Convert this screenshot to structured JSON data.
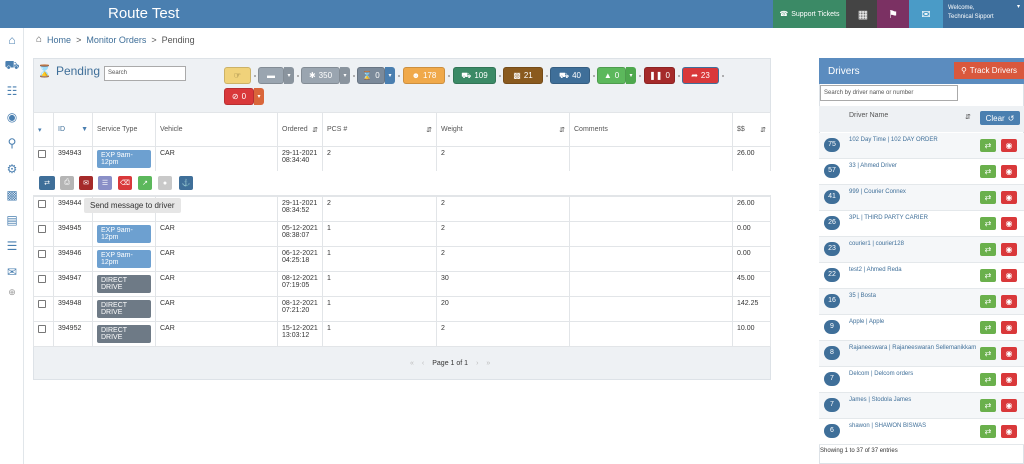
{
  "header": {
    "title": "Route Test",
    "support_label": "Support Tickets",
    "welcome_line1": "Welcome,",
    "welcome_line2": "Technical Sipport",
    "colors": {
      "bar": "#4a7fb0",
      "support": "#3b8a66",
      "notify": "#7b3163",
      "chat": "#4a9bc7"
    }
  },
  "sidebar": {
    "icons": [
      "home-icon",
      "truck-icon",
      "calendar-icon",
      "bicycle-icon",
      "search-icon",
      "gear-icon",
      "building-icon",
      "book-icon",
      "list-icon",
      "envelope-icon",
      "expand-icon"
    ]
  },
  "breadcrumb": {
    "home": "Home",
    "sep1": ">",
    "monitor": "Monitor Orders",
    "sep2": ">",
    "current": "Pending"
  },
  "pending": {
    "title": "Pending",
    "search_placeholder": "Search",
    "filters": [
      {
        "name": "pickup-filter",
        "label": "",
        "color": "#f0d27a"
      },
      {
        "name": "card-filter",
        "label": "",
        "color": "#9aa5b0"
      },
      {
        "name": "all-filter",
        "label": "350",
        "color": "#9aa5b0"
      },
      {
        "name": "hourglass-filter",
        "label": "0",
        "color": "#4a7fb0"
      },
      {
        "name": "assigned-filter",
        "label": "178",
        "color": "#f0a94a"
      },
      {
        "name": "car-filter",
        "label": "109",
        "color": "#3b8a66"
      },
      {
        "name": "warehouse-filter",
        "label": "21",
        "color": "#8a5a1e"
      },
      {
        "name": "delivery-filter",
        "label": "40",
        "color": "#3f6f99"
      },
      {
        "name": "delivered-filter",
        "label": "0",
        "color": "#5cb85c"
      },
      {
        "name": "paused-filter",
        "label": "0",
        "color": "#a52a2a"
      },
      {
        "name": "returned-filter",
        "label": "23",
        "color": "#d9383a"
      },
      {
        "name": "cancelled-filter",
        "label": "0",
        "color": "#d9383a"
      }
    ]
  },
  "table": {
    "columns": [
      "",
      "ID",
      "Service Type",
      "Vehicle",
      "Ordered",
      "PCS #",
      "Weight",
      "Comments",
      "$$"
    ],
    "rows": [
      {
        "id": "394943",
        "service": "EXP 9am-12pm",
        "vehicle": "CAR",
        "ordered_date": "29-11-2021",
        "ordered_time": "08:34:40",
        "pcs": "2",
        "weight": "2",
        "comments": "",
        "amount": "26.00"
      },
      {
        "id": "394944",
        "service": "",
        "vehicle": "",
        "ordered_date": "29-11-2021",
        "ordered_time": "08:34:52",
        "pcs": "2",
        "weight": "2",
        "comments": "",
        "amount": "26.00"
      },
      {
        "id": "394945",
        "service": "EXP 9am-12pm",
        "vehicle": "CAR",
        "ordered_date": "05-12-2021",
        "ordered_time": "08:38:07",
        "pcs": "1",
        "weight": "2",
        "comments": "",
        "amount": "0.00"
      },
      {
        "id": "394946",
        "service": "EXP 9am-12pm",
        "vehicle": "CAR",
        "ordered_date": "06-12-2021",
        "ordered_time": "04:25:18",
        "pcs": "1",
        "weight": "2",
        "comments": "",
        "amount": "0.00"
      },
      {
        "id": "394947",
        "service": "DIRECT DRIVE",
        "vehicle": "CAR",
        "ordered_date": "08-12-2021",
        "ordered_time": "07:19:05",
        "pcs": "1",
        "weight": "30",
        "comments": "",
        "amount": "45.00"
      },
      {
        "id": "394948",
        "service": "DIRECT DRIVE",
        "vehicle": "CAR",
        "ordered_date": "08-12-2021",
        "ordered_time": "07:21:20",
        "pcs": "1",
        "weight": "20",
        "comments": "",
        "amount": "142.25"
      },
      {
        "id": "394952",
        "service": "DIRECT DRIVE",
        "vehicle": "CAR",
        "ordered_date": "15-12-2021",
        "ordered_time": "13:03:12",
        "pcs": "1",
        "weight": "2",
        "comments": "",
        "amount": "10.00"
      }
    ],
    "tooltip": "Send message to driver",
    "pager": "Page 1 of 1"
  },
  "drivers": {
    "title": "Drivers",
    "track_label": "Track Drivers",
    "search_placeholder": "Search by driver name or number",
    "column": "Driver Name",
    "clear_label": "Clear",
    "list": [
      {
        "count": "75",
        "name": "102 Day Time | 102 DAY ORDER"
      },
      {
        "count": "57",
        "name": "33 | Ahmed Driver"
      },
      {
        "count": "41",
        "name": "999 | Courier Connex"
      },
      {
        "count": "26",
        "name": "3PL | THIRD PARTY CARIER"
      },
      {
        "count": "23",
        "name": "courier1 | courier128"
      },
      {
        "count": "22",
        "name": "test2 | Ahmed Reda"
      },
      {
        "count": "16",
        "name": "35 | Bosta"
      },
      {
        "count": "9",
        "name": "Apple | Apple"
      },
      {
        "count": "8",
        "name": "Rajaneeswara | Rajaneeswaran Sellemanikkam"
      },
      {
        "count": "7",
        "name": "Delcom | Delcom orders"
      },
      {
        "count": "7",
        "name": "James | Stodola James"
      },
      {
        "count": "6",
        "name": "shawon | SHAWON BISWAS"
      }
    ],
    "footer": "Showing 1 to 37 of 37 entries"
  }
}
